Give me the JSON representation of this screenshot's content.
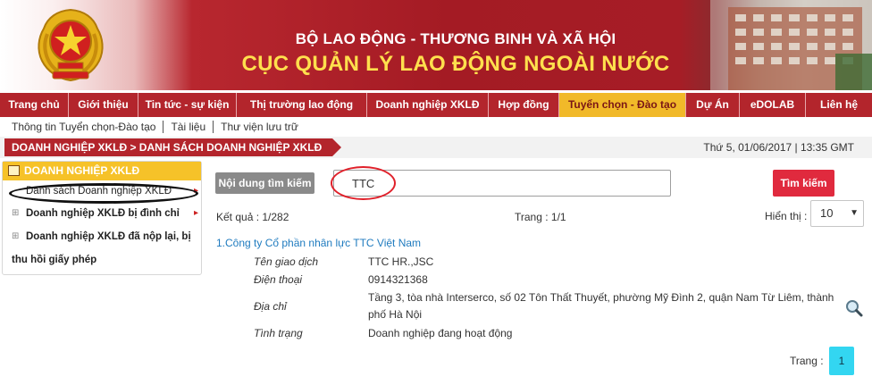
{
  "header": {
    "line1": "BỘ LAO ĐỘNG - THƯƠNG BINH VÀ XÃ HỘI",
    "line2": "CỤC QUẢN LÝ LAO ĐỘNG NGOÀI NƯỚC"
  },
  "nav": [
    {
      "label": "Trang chủ",
      "active": false
    },
    {
      "label": "Giới thiệu",
      "active": false
    },
    {
      "label": "Tin tức - sự kiện",
      "active": false
    },
    {
      "label": "Thị trường lao động",
      "active": false
    },
    {
      "label": "Doanh nghiệp XKLĐ",
      "active": false
    },
    {
      "label": "Hợp đồng",
      "active": false
    },
    {
      "label": "Tuyển chọn - Đào tạo",
      "active": true
    },
    {
      "label": "Dự Án",
      "active": false
    },
    {
      "label": "eDOLAB",
      "active": false
    },
    {
      "label": "Liên hệ",
      "active": false
    }
  ],
  "subnav": [
    "Thông tin Tuyển chọn-Đào tạo",
    "Tài liệu",
    "Thư viện lưu trữ"
  ],
  "breadcrumb": "DOANH NGHIỆP XKLĐ > DANH SÁCH DOANH NGHIỆP XKLĐ",
  "datetime": "Thứ 5, 01/06/2017 | 13:35 GMT",
  "sidebar": {
    "title": "DOANH NGHIỆP XKLĐ",
    "items": [
      {
        "label": "Danh sách Doanh nghiệp XKLĐ"
      },
      {
        "label": "Doanh nghiệp XKLĐ bị đình chỉ"
      },
      {
        "label_line1": "Doanh nghiệp XKLĐ đã nộp lại, bị",
        "label_line2": "thu hồi giấy phép"
      }
    ]
  },
  "search": {
    "label": "Nội dung tìm kiếm",
    "value": "TTC",
    "button": "Tìm kiếm"
  },
  "results": {
    "count": "Kết quả : 1/282",
    "page": "Trang : 1/1",
    "show_label": "Hiển thị :",
    "show_value": "10"
  },
  "company": {
    "index": "1.",
    "name": "Công ty Cổ phần nhân lực TTC Việt Nam",
    "fields": {
      "trade_name_label": "Tên giao dịch",
      "trade_name": "TTC HR.,JSC",
      "phone_label": "Điện thoại",
      "phone": "0914321368",
      "address_label": "Địa chỉ",
      "address_line1": "Tầng 3, tòa nhà Interserco, số 02 Tôn Thất Thuyết, phường Mỹ Đình 2, quận Nam Từ Liêm, thành",
      "address_line2": "phố Hà Nội",
      "status_label": "Tình trạng",
      "status": "Doanh nghiệp đang hoạt động"
    }
  },
  "pager": {
    "label": "Trang :",
    "current": "1"
  },
  "colors": {
    "nav_red": "#b3252c",
    "active_gold": "#f1b929",
    "link_blue": "#1f7bbf",
    "search_red": "#e02a3e",
    "pager_cyan": "#33d6f1"
  }
}
